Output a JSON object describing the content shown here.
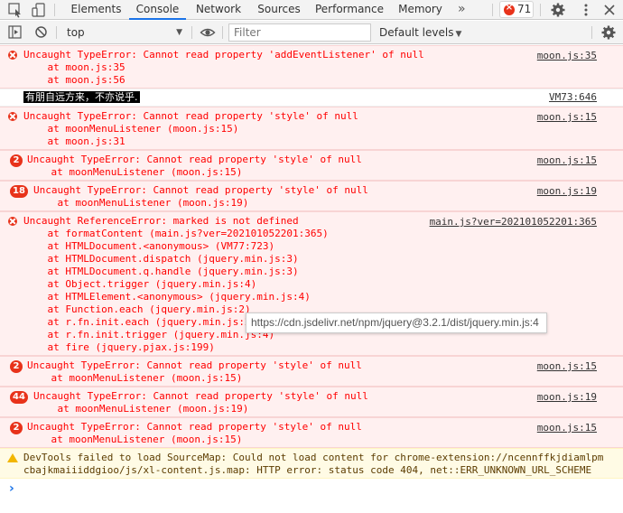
{
  "tabs": [
    "Elements",
    "Console",
    "Network",
    "Sources",
    "Performance",
    "Memory"
  ],
  "active_tab": "Console",
  "more_tabs": "»",
  "error_count": "71",
  "context": "top",
  "filter_placeholder": "Filter",
  "levels_label": "Default levels",
  "tooltip": "https://cdn.jsdelivr.net/npm/jquery@3.2.1/dist/jquery.min.js:4",
  "messages": {
    "m1": {
      "text": "Uncaught TypeError: Cannot read property 'addEventListener' of null",
      "s1": "    at moon.js:35",
      "s2": "    at moon.js:56",
      "src": "moon.js:35"
    },
    "m2": {
      "text": "有朋自远方来，不亦说乎.",
      "src": "VM73:646"
    },
    "m3": {
      "text": "Uncaught TypeError: Cannot read property 'style' of null",
      "s1": "    at moonMenuListener (moon.js:15)",
      "s2": "    at moon.js:31",
      "src": "moon.js:15"
    },
    "m4": {
      "count": "2",
      "text": "Uncaught TypeError: Cannot read property 'style' of null",
      "s1": "    at moonMenuListener (moon.js:15)",
      "src": "moon.js:15"
    },
    "m5": {
      "count": "18",
      "text": "Uncaught TypeError: Cannot read property 'style' of null",
      "s1": "    at moonMenuListener (moon.js:19)",
      "src": "moon.js:19"
    },
    "m6": {
      "text": "Uncaught ReferenceError: marked is not defined",
      "src": "main.js?ver=202101052201:365",
      "stack": [
        "    at formatContent (main.js?ver=202101052201:365)",
        "    at HTMLDocument.<anonymous> (VM77:723)",
        "    at HTMLDocument.dispatch (jquery.min.js:3)",
        "    at HTMLDocument.q.handle (jquery.min.js:3)",
        "    at Object.trigger (jquery.min.js:4)",
        "    at HTMLElement.<anonymous> (jquery.min.js:4)",
        "    at Function.each (jquery.min.js:2)",
        "    at r.fn.init.each (jquery.min.js:2)",
        "    at r.fn.init.trigger (jquery.min.js:4)",
        "    at fire (jquery.pjax.js:199)"
      ]
    },
    "m7": {
      "count": "2",
      "text": "Uncaught TypeError: Cannot read property 'style' of null",
      "s1": "    at moonMenuListener (moon.js:15)",
      "src": "moon.js:15"
    },
    "m8": {
      "count": "44",
      "text": "Uncaught TypeError: Cannot read property 'style' of null",
      "s1": "    at moonMenuListener (moon.js:19)",
      "src": "moon.js:19"
    },
    "m9": {
      "count": "2",
      "text": "Uncaught TypeError: Cannot read property 'style' of null",
      "s1": "    at moonMenuListener (moon.js:15)",
      "src": "moon.js:15"
    },
    "m10": {
      "l1": "DevTools failed to load SourceMap: Could not load content for chrome-extension://ncennffkjdiamlpm",
      "l2": "cbajkmaiiiddgioo/js/xl-content.js.map: HTTP error: status code 404, net::ERR_UNKNOWN_URL_SCHEME"
    }
  },
  "prompt_symbol": "›",
  "colors": {
    "error_bg": "#fff0f0",
    "error_text": "#ff0000",
    "accent": "#1a73e8",
    "warn_bg": "#fffbe5"
  }
}
